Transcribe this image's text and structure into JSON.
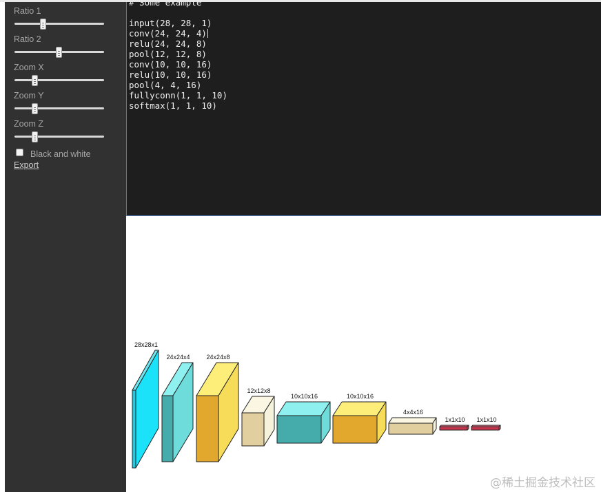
{
  "sidebar": {
    "controls": [
      {
        "label": "Ratio 1",
        "value": 0.32
      },
      {
        "label": "Ratio 2",
        "value": 0.5
      },
      {
        "label": "Zoom X",
        "value": 0.23
      },
      {
        "label": "Zoom Y",
        "value": 0.23
      },
      {
        "label": "Zoom Z",
        "value": 0.23
      }
    ],
    "black_and_white": {
      "label": "Black and white",
      "checked": false
    },
    "export_label": "Export"
  },
  "editor": {
    "lines": [
      "# Some example",
      "",
      "input(28, 28, 1)",
      "conv(24, 24, 4)",
      "relu(24, 24, 8)",
      "pool(12, 12, 8)",
      "conv(10, 10, 16)",
      "relu(10, 10, 16)",
      "pool(4, 4, 16)",
      "fullyconn(1, 1, 10)",
      "softmax(1, 1, 10)"
    ],
    "cursor_line": 3
  },
  "network": {
    "layers": [
      {
        "label": "28x28x1",
        "type": "input",
        "front": "#1ccce6",
        "side": "#1be2f8",
        "top": "#6fe6ef"
      },
      {
        "label": "24x24x4",
        "type": "conv",
        "front": "#45abab",
        "side": "#6fdcdc",
        "top": "#8ff0f0"
      },
      {
        "label": "24x24x8",
        "type": "relu",
        "front": "#e2a82e",
        "side": "#f7dc5a",
        "top": "#fdee7a"
      },
      {
        "label": "12x12x8",
        "type": "pool",
        "front": "#e2cfa0",
        "side": "#f6f3dc",
        "top": "#faf6e2"
      },
      {
        "label": "10x10x16",
        "type": "conv",
        "front": "#45abab",
        "side": "#6fdcdc",
        "top": "#8ff0f0"
      },
      {
        "label": "10x10x16",
        "type": "relu",
        "front": "#e2a82e",
        "side": "#f7dc5a",
        "top": "#fdee7a"
      },
      {
        "label": "4x4x16",
        "type": "pool",
        "front": "#e2cfa0",
        "side": "#f6f3dc",
        "top": "#faf6e2"
      },
      {
        "label": "1x1x10",
        "type": "fullyconn",
        "front": "#c8364e",
        "side": "#e85a72",
        "top": "#f07a8e"
      },
      {
        "label": "1x1x10",
        "type": "softmax",
        "front": "#c8364e",
        "side": "#e85a72",
        "top": "#f07a8e"
      }
    ]
  },
  "watermark": "@稀土掘金技术社区"
}
